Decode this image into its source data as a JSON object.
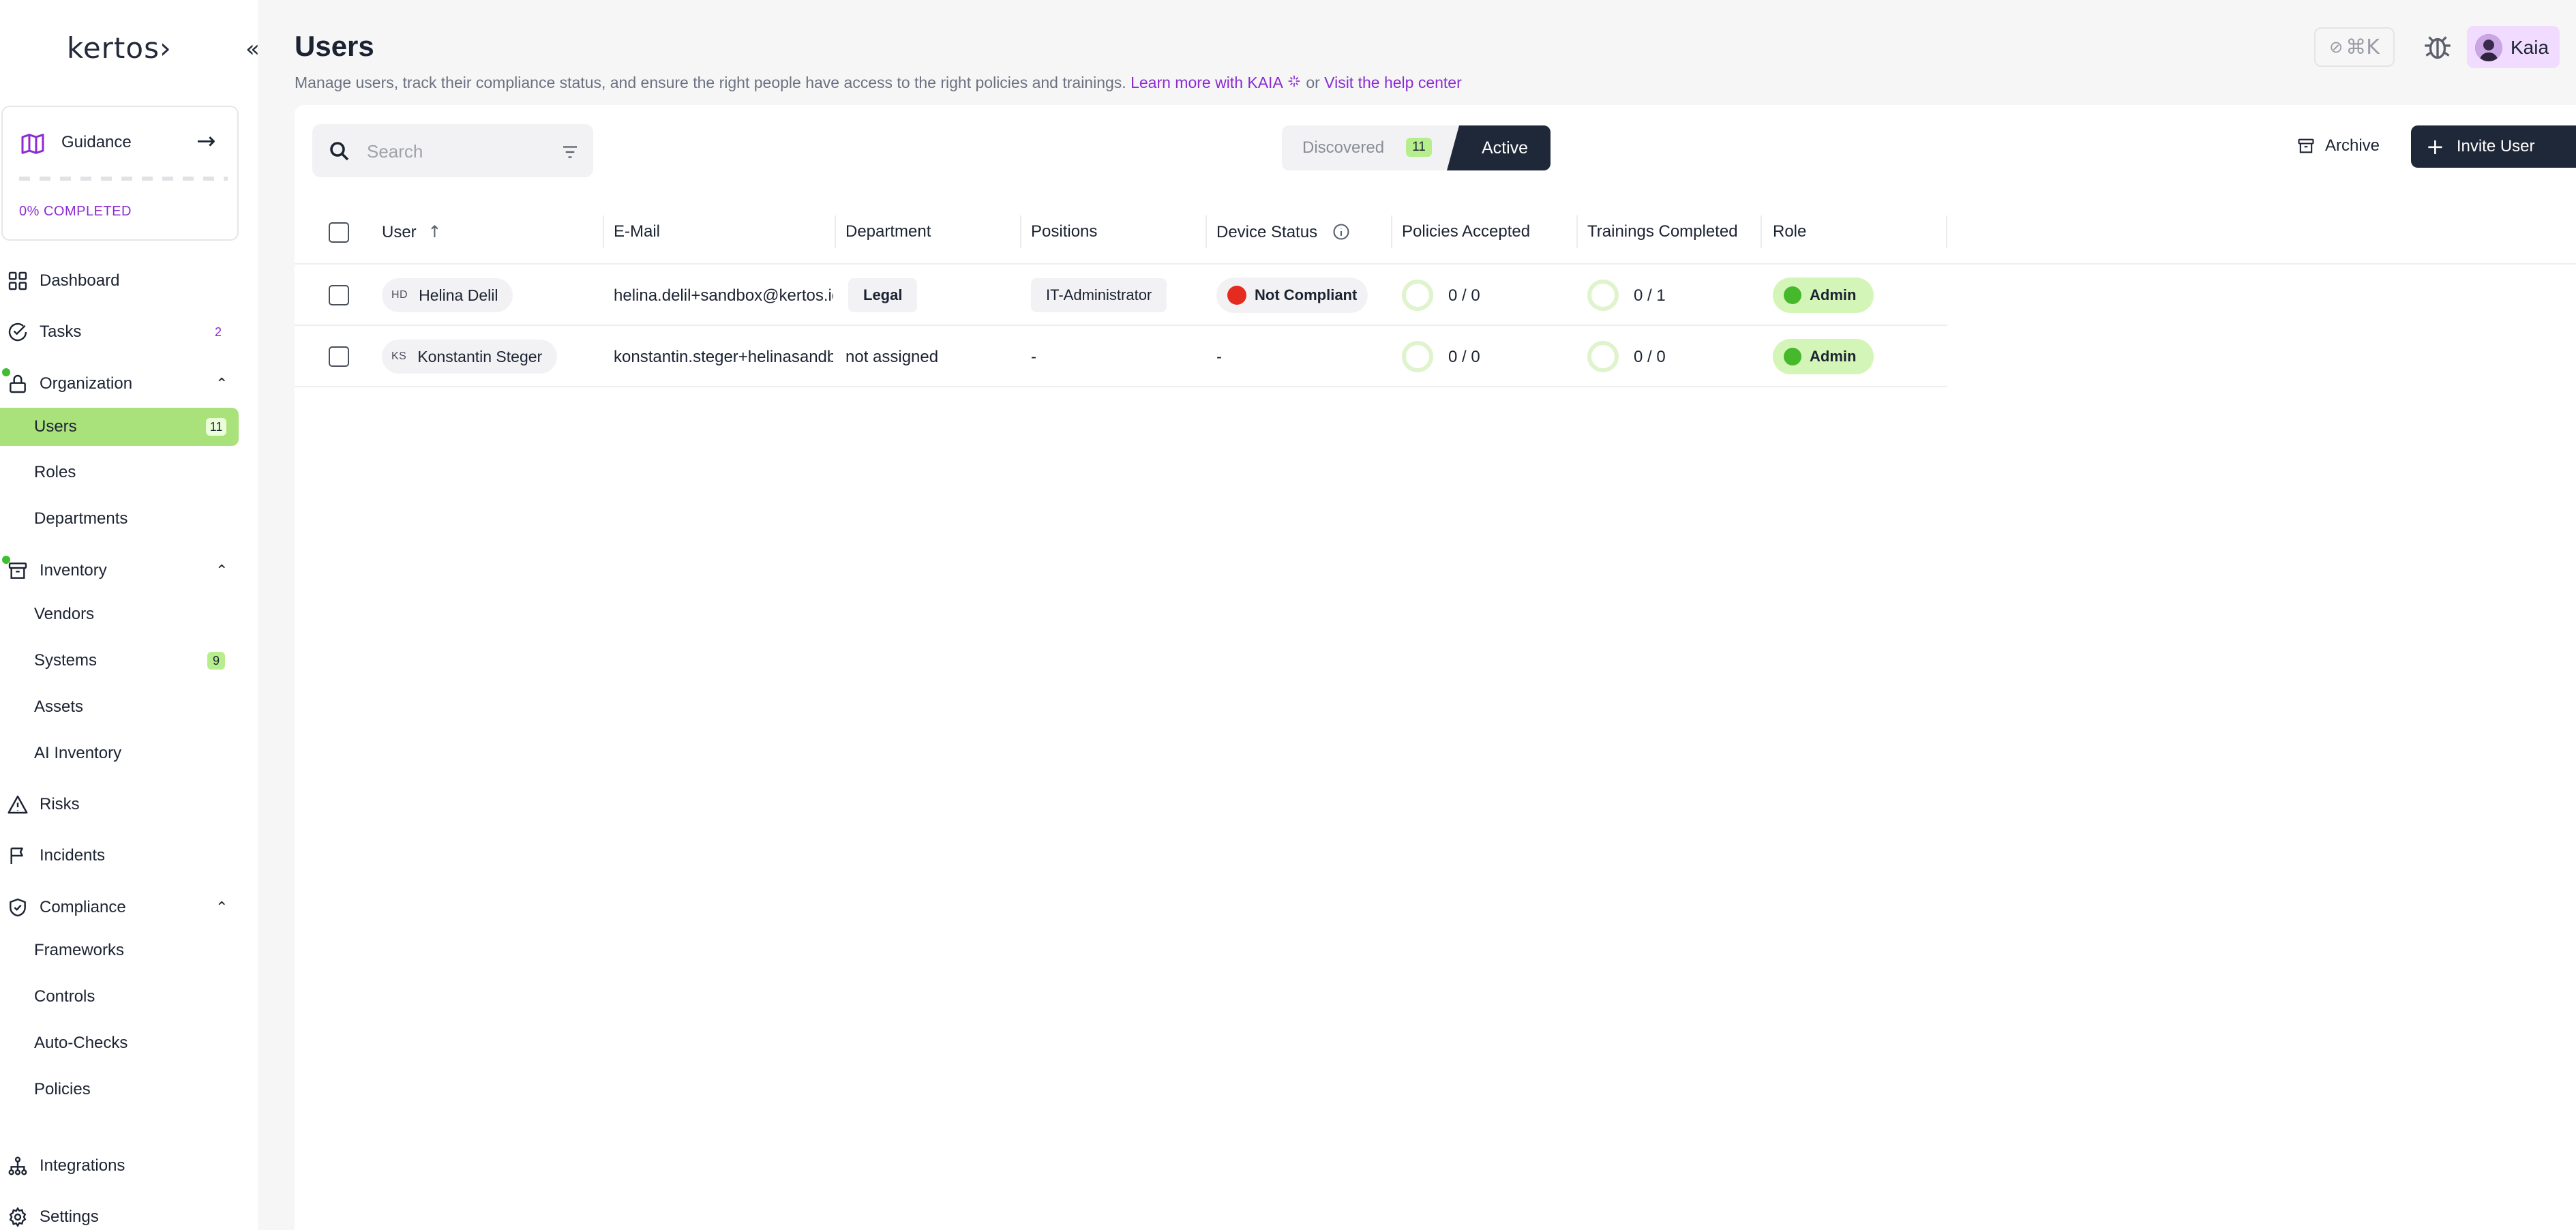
{
  "sidebar": {
    "logo": "kertos›",
    "collapse_icon": "«",
    "guidance": {
      "label": "Guidance",
      "arrow": "→",
      "progress_text": "0% COMPLETED",
      "progress": 0
    },
    "nav": {
      "dashboard": "Dashboard",
      "tasks": "Tasks",
      "tasks_count": "2",
      "organization": "Organization",
      "users": "Users",
      "users_count": "11",
      "roles": "Roles",
      "departments": "Departments",
      "inventory": "Inventory",
      "vendors": "Vendors",
      "systems": "Systems",
      "systems_count": "9",
      "assets": "Assets",
      "ai_inventory": "AI Inventory",
      "risks": "Risks",
      "incidents": "Incidents",
      "compliance": "Compliance",
      "frameworks": "Frameworks",
      "controls": "Controls",
      "auto_checks": "Auto-Checks",
      "policies": "Policies",
      "integrations": "Integrations",
      "settings": "Settings"
    },
    "chevron_up": "⌃"
  },
  "header": {
    "title": "Users",
    "subtitle": "Manage users, track their compliance status, and ensure the right people have access to the right policies and trainings.",
    "learn_more": "Learn more with KAIA",
    "or": "or",
    "help_link": "Visit the help center",
    "kbar": "⌘K",
    "user_name": "Kaia"
  },
  "toolbar": {
    "search_placeholder": "Search",
    "tab_discovered": "Discovered",
    "tab_discovered_count": "11",
    "tab_active": "Active",
    "archive": "Archive",
    "invite": "Invite User",
    "plus": "+"
  },
  "table": {
    "headers": {
      "user": "User",
      "sort_icon": "↑",
      "email": "E-Mail",
      "department": "Department",
      "positions": "Positions",
      "device_status": "Device Status",
      "policies": "Policies Accepted",
      "trainings": "Trainings Completed",
      "role": "Role"
    },
    "rows": [
      {
        "initials": "HD",
        "name": "Helina Delil",
        "email": "helina.delil+sandbox@kertos.io",
        "department": "Legal",
        "position": "IT-Administrator",
        "device_status": "Not Compliant",
        "policies": "0 / 0",
        "trainings": "0 / 1",
        "role": "Admin"
      },
      {
        "initials": "KS",
        "name": "Konstantin Steger",
        "email": "konstantin.steger+helinasandbox@kertos.io",
        "department": "not assigned",
        "position": "-",
        "device_status": "-",
        "policies": "0 / 0",
        "trainings": "0 / 0",
        "role": "Admin"
      }
    ]
  },
  "colors": {
    "accent_purple": "#8b2bd2",
    "active_green": "#a9e27a",
    "dark_navy": "#1f2838",
    "status_red": "#e52a1f",
    "role_green": "#45b82b"
  }
}
